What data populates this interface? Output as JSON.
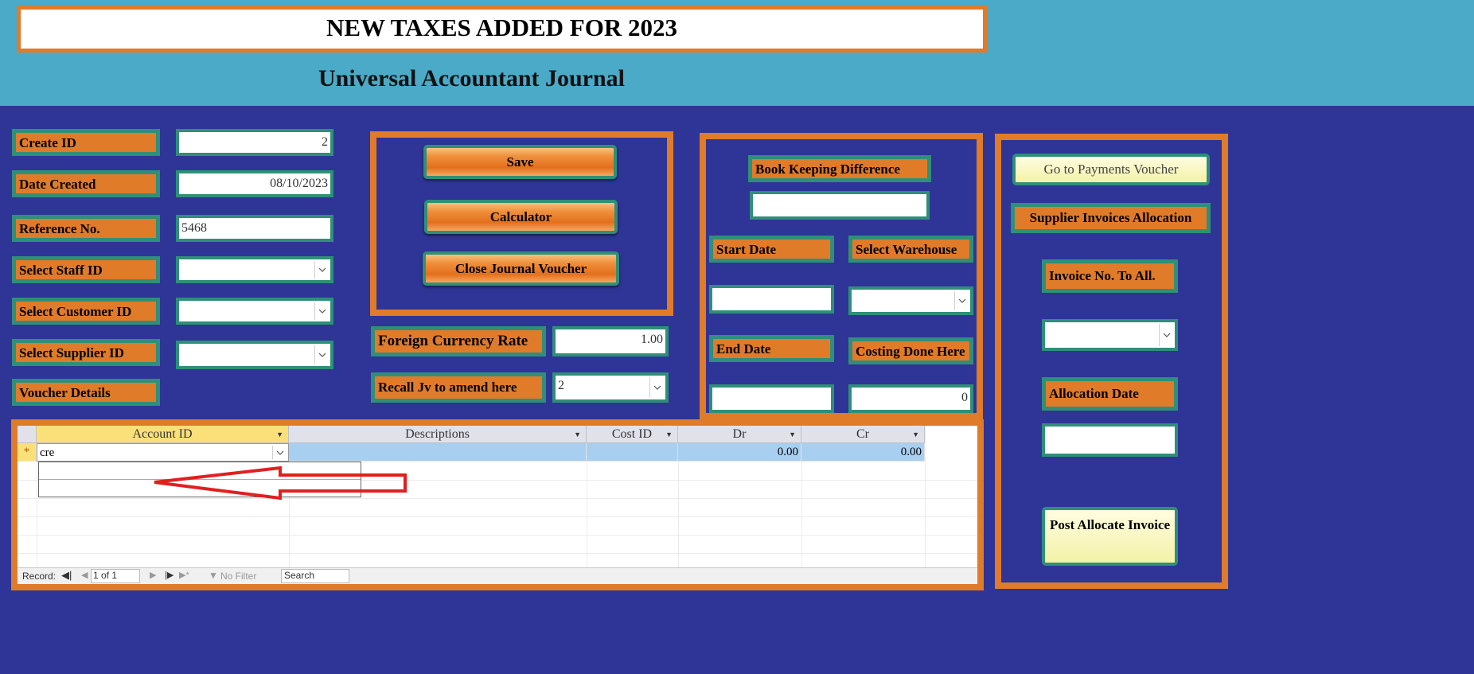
{
  "banner": {
    "title": "NEW TAXES ADDED FOR 2023"
  },
  "header": {
    "subtitle": "Universal Accountant Journal"
  },
  "left_form": {
    "create_id_label": "Create ID",
    "create_id_value": "2",
    "date_created_label": "Date Created",
    "date_created_value": "08/10/2023",
    "reference_label": "Reference No.",
    "reference_value": "5468",
    "staff_label": "Select Staff ID",
    "customer_label": "Select Customer ID",
    "supplier_label": "Select Supplier ID",
    "voucher_details_label": "Voucher Details"
  },
  "actions": {
    "save_label": "Save",
    "calculator_label": "Calculator",
    "close_label": "Close Journal Voucher"
  },
  "currency": {
    "label": "Foreign Currency Rate",
    "value": "1.00",
    "recall_label": "Recall Jv to amend here",
    "recall_value": "2"
  },
  "bookkeeping": {
    "difference_label": "Book Keeping Difference",
    "start_date_label": "Start Date",
    "warehouse_label": "Select Warehouse",
    "end_date_label": "End Date",
    "costing_label": "Costing Done Here",
    "costing_value": "0"
  },
  "allocation": {
    "payments_button": "Go to Payments Voucher",
    "supplier_invoices_label": "Supplier Invoices Allocation",
    "invoice_no_label": "Invoice No. To All.",
    "allocation_date_label": "Allocation Date",
    "post_button": "Post Allocate Invoice"
  },
  "grid": {
    "columns": [
      "Account ID",
      "Descriptions",
      "Cost ID",
      "Dr",
      "Cr"
    ],
    "new_row": {
      "marker": "*",
      "account_id": "cre",
      "dr": "0.00",
      "cr": "0.00"
    }
  },
  "navigation": {
    "record_label": "Record:",
    "record_position": "1 of 1",
    "filter_label": "No Filter",
    "search_placeholder": "Search"
  },
  "colors": {
    "background": "#2e3596",
    "header_band": "#4aaac8",
    "label_orange": "#e07b2a",
    "border_green": "#2f8f78",
    "arrow_red": "#e02020"
  }
}
